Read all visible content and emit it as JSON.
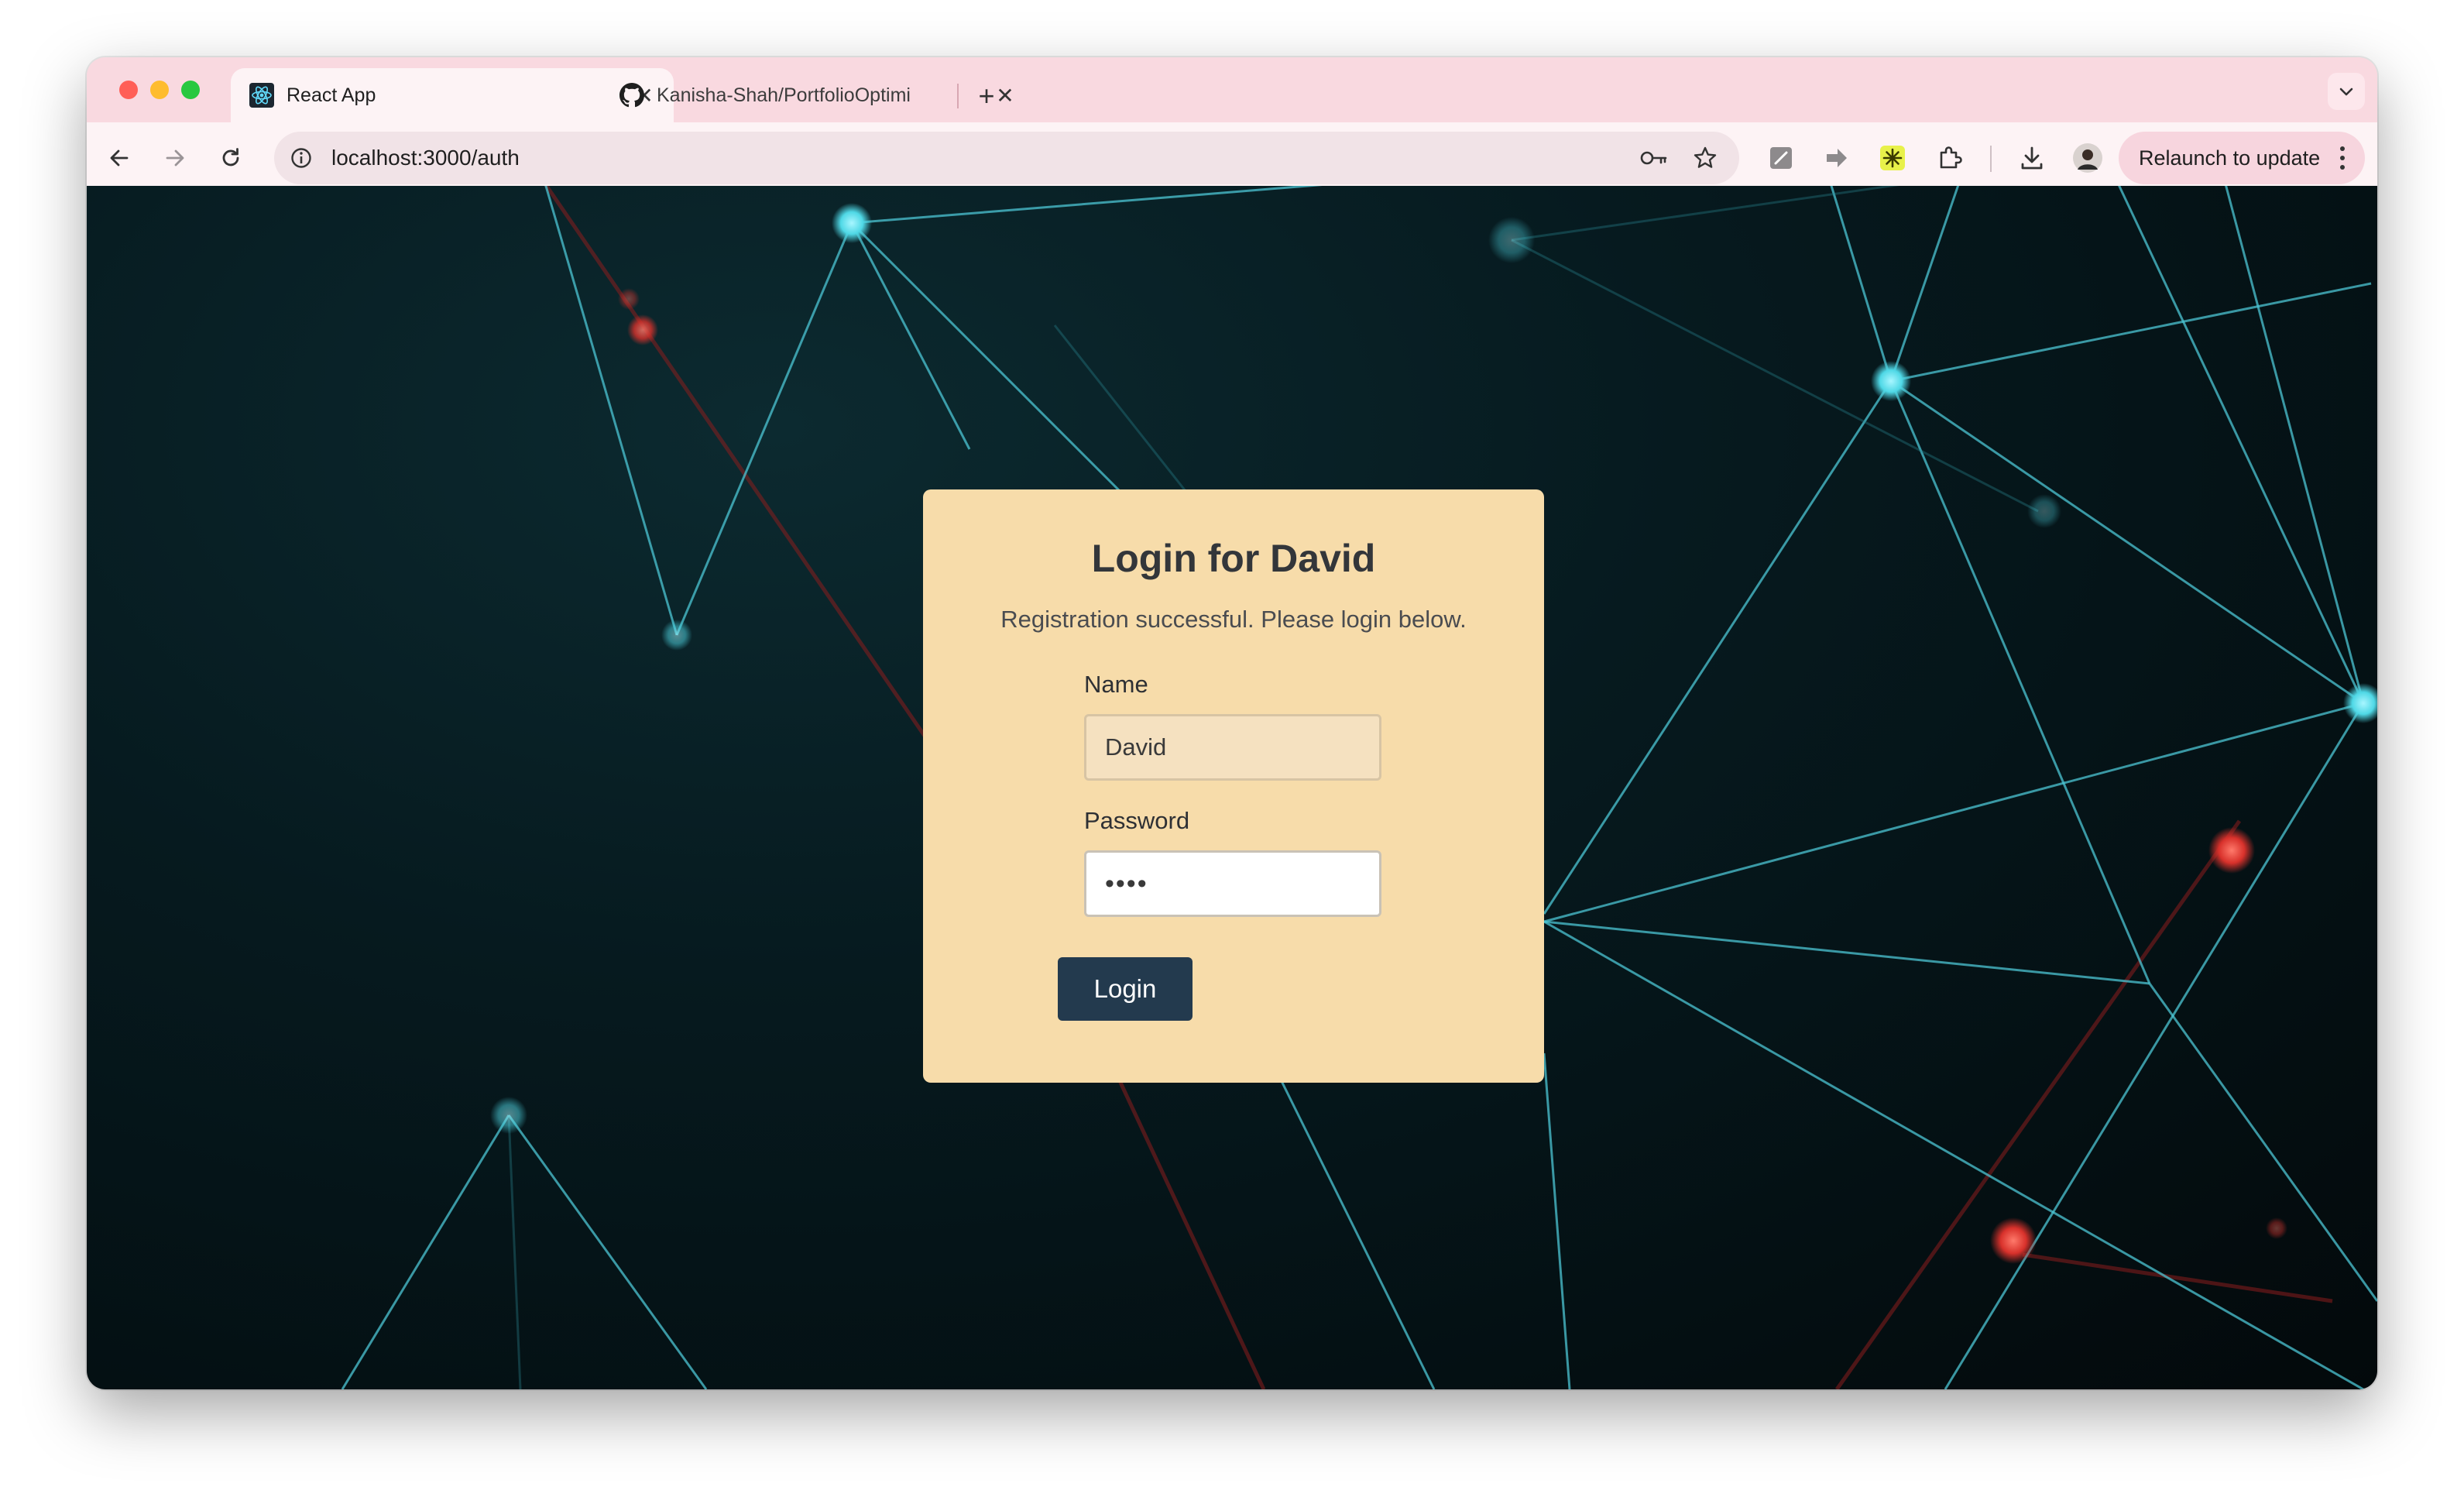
{
  "browser": {
    "tabs": [
      {
        "title": "React App",
        "active": true
      },
      {
        "title": "Kanisha-Shah/PortfolioOptimi",
        "active": false
      }
    ],
    "url": "localhost:3000/auth",
    "relaunch_label": "Relaunch to update"
  },
  "login": {
    "title": "Login for David",
    "message": "Registration successful. Please login below.",
    "name_label": "Name",
    "name_value": "David",
    "password_label": "Password",
    "password_value": "••••",
    "button_label": "Login"
  },
  "colors": {
    "card_bg": "#f7dcaa",
    "button_bg": "#233a4e",
    "tab_strip": "#f9d9e0",
    "network_cyan": "#4fd8e6",
    "network_red": "#e23a33"
  }
}
